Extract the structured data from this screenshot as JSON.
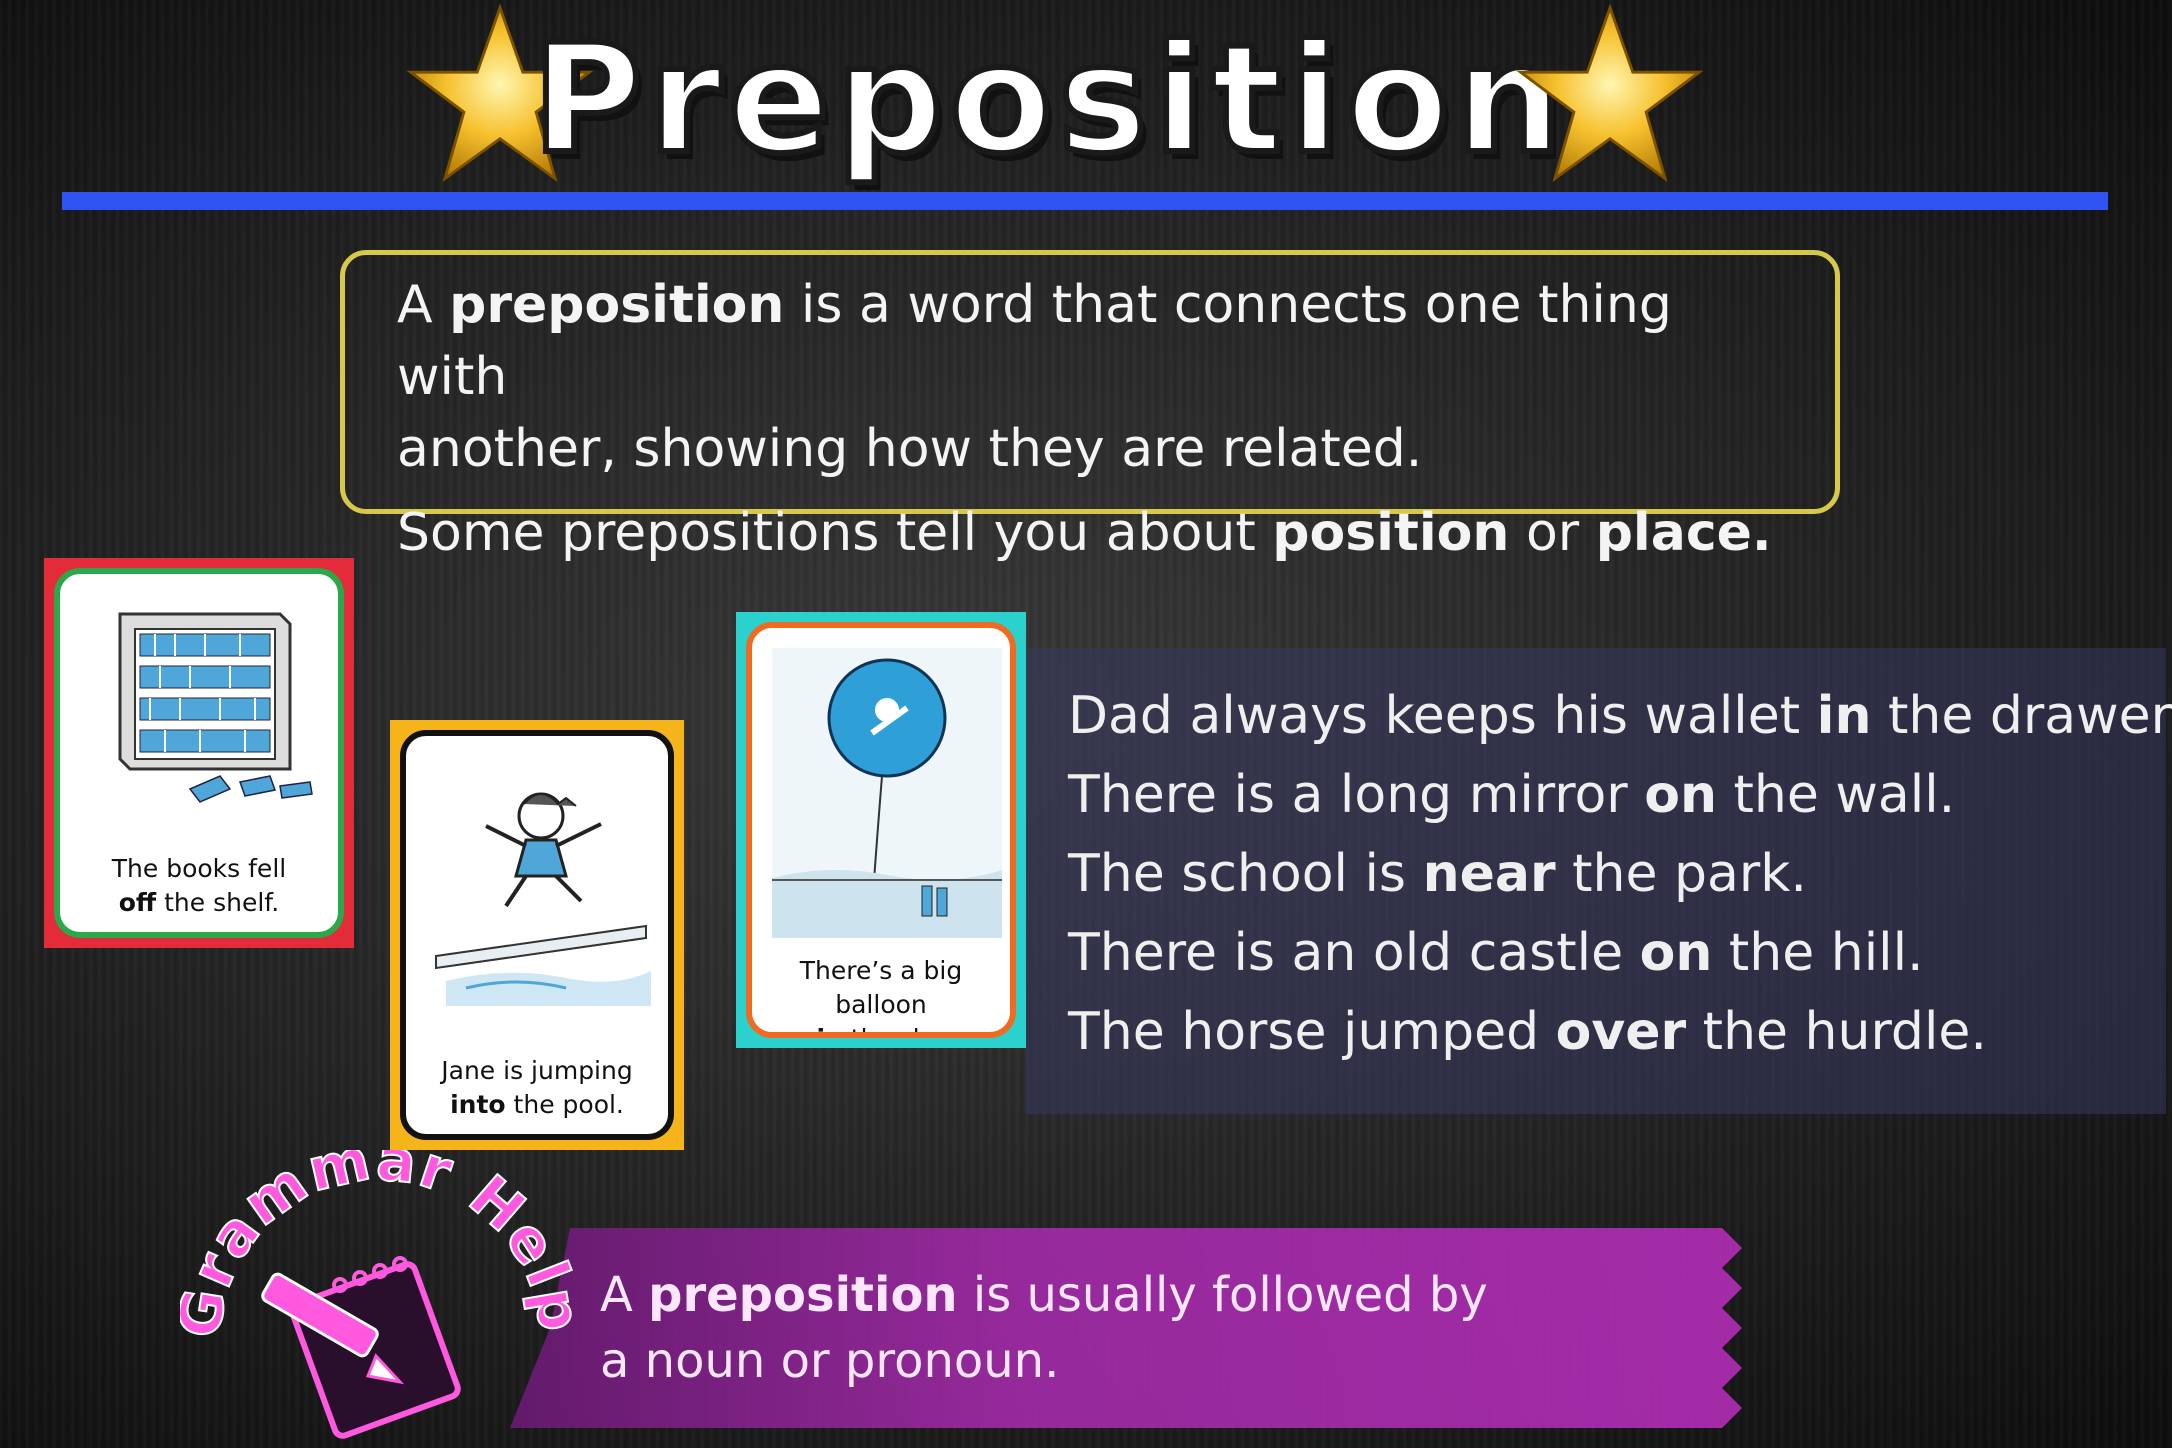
{
  "title": "Preposition",
  "colors": {
    "rule": "#2f52f2",
    "def_border": "#d6c94a",
    "card1_outer": "#e32b3a",
    "card1_inner": "#2aa84a",
    "card2_outer": "#f6b41b",
    "card2_inner": "#111111",
    "card3_outer": "#2bd1cc",
    "card3_inner": "#f06a21",
    "ribbon": "#b32db8"
  },
  "definition": {
    "line1_a": "A ",
    "line1_b": "preposition",
    "line1_c": " is a word that connects one thing with",
    "line2": "another, showing how they are related.",
    "line3_a": "Some prepositions tell you about ",
    "line3_b": "position",
    "line3_c": " or ",
    "line3_d": "place."
  },
  "cards": [
    {
      "line1": "The books fell",
      "bold": "off",
      "rest": " the shelf.",
      "icon": "bookshelf-icon"
    },
    {
      "line1": "Jane is jumping",
      "bold": "into",
      "rest": " the pool.",
      "icon": "girl-jumping-icon"
    },
    {
      "line1": "There’s a big balloon",
      "bold": "in",
      "rest": " the sky.",
      "icon": "balloon-icon"
    }
  ],
  "sentences": [
    {
      "a": "Dad always keeps his wallet ",
      "b": "in",
      "c": " the drawer."
    },
    {
      "a": "There is a long mirror ",
      "b": "on",
      "c": " the wall."
    },
    {
      "a": "The school is ",
      "b": "near",
      "c": " the park."
    },
    {
      "a": "There is an old castle ",
      "b": "on",
      "c": " the hill."
    },
    {
      "a": "The horse jumped ",
      "b": "over",
      "c": " the hurdle."
    }
  ],
  "grammar_help": {
    "badge": "Grammar Help",
    "line1_a": "A ",
    "line1_b": "preposition",
    "line1_c": " is usually followed by",
    "line2": "a noun or pronoun."
  }
}
